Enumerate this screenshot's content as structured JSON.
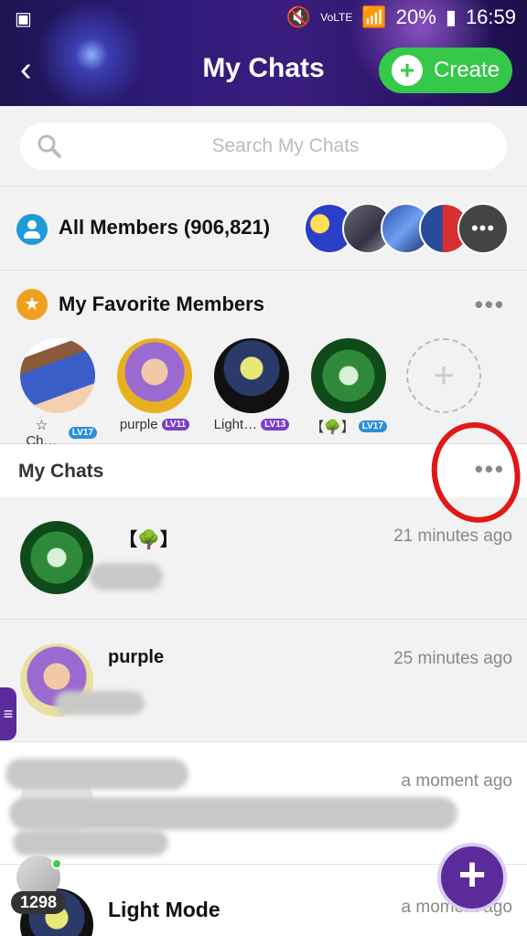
{
  "status": {
    "signal_label": "VoLTE",
    "battery": "20%",
    "time": "16:59"
  },
  "header": {
    "title": "My Chats",
    "create_label": "Create"
  },
  "search": {
    "placeholder": "Search My Chats"
  },
  "all_members": {
    "label": "All Members (906,821)"
  },
  "favorites": {
    "label": "My Favorite Members",
    "members": [
      {
        "name": "☆ Ch…",
        "level": "LV17"
      },
      {
        "name": "purple",
        "level": "LV11"
      },
      {
        "name": "Light…",
        "level": "LV13"
      },
      {
        "name": "【🌳】",
        "level": "LV17"
      }
    ]
  },
  "my_chats": {
    "title": "My Chats",
    "items": [
      {
        "name": "【🌳】",
        "time": "21 minutes ago"
      },
      {
        "name": "purple",
        "time": "25 minutes ago"
      },
      {
        "name": "",
        "time": "a moment ago"
      },
      {
        "name": "Light Mode",
        "time": "a moment ago"
      }
    ]
  },
  "badge_count": "1298",
  "colors": {
    "accent_green": "#35c84a",
    "accent_purple": "#5b2b9c",
    "annotation_red": "#e01818"
  }
}
